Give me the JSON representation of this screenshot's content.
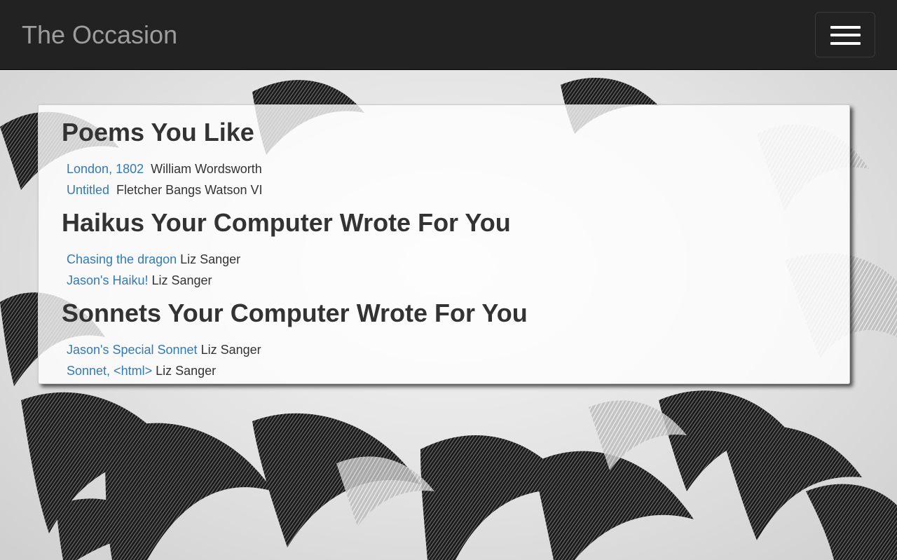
{
  "navbar": {
    "brand": "The Occasion",
    "toggle_icon": "hamburger-menu-icon"
  },
  "sections": [
    {
      "title": "Poems You Like",
      "entries": [
        {
          "title": "London, 1802",
          "author": "William Wordsworth"
        },
        {
          "title": "Untitled",
          "author": "Fletcher Bangs Watson VI"
        }
      ]
    },
    {
      "title": "Haikus Your Computer Wrote For You",
      "entries": [
        {
          "title": "Chasing the dragon",
          "author": "Liz Sanger"
        },
        {
          "title": "Jason's Haiku!",
          "author": "Liz Sanger"
        }
      ]
    },
    {
      "title": "Sonnets Your Computer Wrote For You",
      "entries": [
        {
          "title": "Jason's Special Sonnet",
          "author": "Liz Sanger"
        },
        {
          "title": "Sonnet, <html>",
          "author": "Liz Sanger"
        }
      ]
    }
  ],
  "colors": {
    "navbar_bg": "#222222",
    "brand_text": "#9d9d9d",
    "link": "#337ab7",
    "heading": "#333333"
  }
}
